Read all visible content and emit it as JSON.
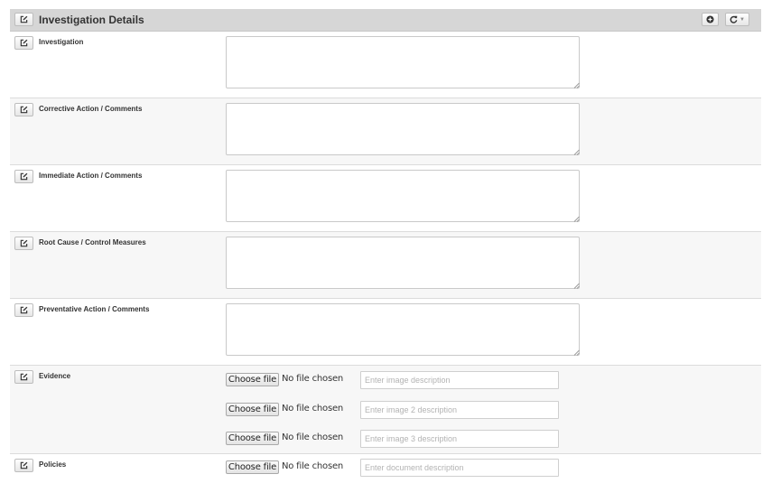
{
  "panel": {
    "title": "Investigation Details",
    "add_icon": "plus-circle-icon",
    "refresh_icon": "refresh-icon"
  },
  "fields": [
    {
      "label": "Investigation",
      "value": ""
    },
    {
      "label": "Corrective Action / Comments",
      "value": ""
    },
    {
      "label": "Immediate Action / Comments",
      "value": ""
    },
    {
      "label": "Root Cause / Control Measures",
      "value": ""
    },
    {
      "label": "Preventative Action / Comments",
      "value": ""
    }
  ],
  "evidence": {
    "label": "Evidence",
    "uploads": [
      {
        "button": "Choose file",
        "status": "No file chosen",
        "placeholder": "Enter image description"
      },
      {
        "button": "Choose file",
        "status": "No file chosen",
        "placeholder": "Enter image 2 description"
      },
      {
        "button": "Choose file",
        "status": "No file chosen",
        "placeholder": "Enter image 3 description"
      }
    ]
  },
  "policies": {
    "label": "Policies",
    "uploads": [
      {
        "button": "Choose file",
        "status": "No file chosen",
        "placeholder": "Enter document description"
      }
    ]
  },
  "colors": {
    "header_bg": "#d6d6d6",
    "row_alt_bg": "#f7f7f7",
    "border": "#dcdcdc"
  }
}
